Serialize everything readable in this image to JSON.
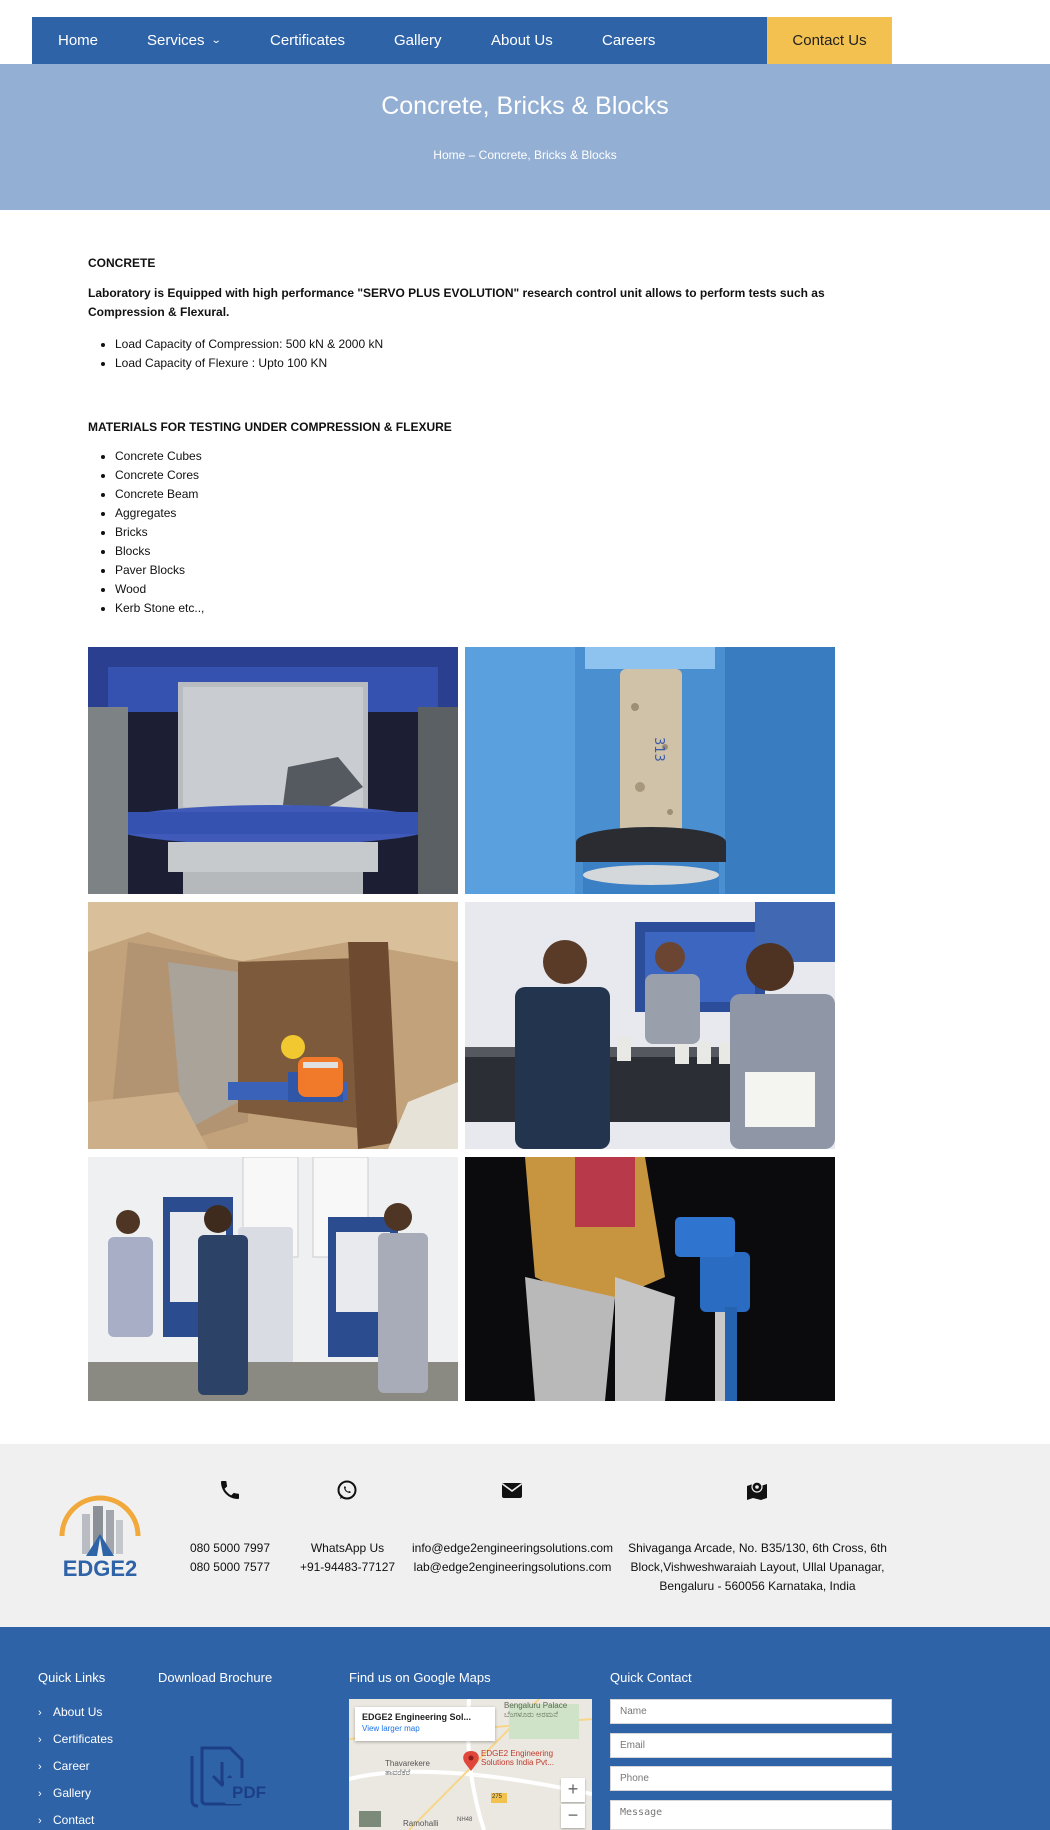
{
  "nav": {
    "items": [
      {
        "label": "Home"
      },
      {
        "label": "Services",
        "has_dropdown": true
      },
      {
        "label": "Certificates"
      },
      {
        "label": "Gallery"
      },
      {
        "label": "About Us"
      },
      {
        "label": "Careers"
      }
    ],
    "contact_label": "Contact Us",
    "dropdown_icon": "chevron-down-icon"
  },
  "hero": {
    "title": "Concrete, Bricks & Blocks",
    "breadcrumb": "Home – Concrete, Bricks & Blocks"
  },
  "content": {
    "section1_heading": "CONCRETE",
    "lead": "Laboratory is Equipped with high performance \"SERVO PLUS EVOLUTION\" research control unit allows to perform tests such as Compression & Flexural.",
    "capacities": [
      "Load Capacity of Compression: 500 kN & 2000 kN",
      "Load Capacity of Flexure : Upto 100 KN"
    ],
    "section2_heading": "MATERIALS FOR TESTING UNDER COMPRESSION & FLEXURE",
    "materials": [
      "Concrete Cubes",
      "Concrete Cores",
      "Concrete Beam",
      "Aggregates",
      "Bricks",
      "Blocks",
      "Paver Blocks",
      "Wood",
      "Kerb Stone etc..,"
    ]
  },
  "gallery": {
    "photos": [
      {
        "name": "concrete-cube-compression-photo"
      },
      {
        "name": "concrete-core-compression-photo"
      },
      {
        "name": "field-core-cutting-pit-photo"
      },
      {
        "name": "lab-technicians-samples-photo"
      },
      {
        "name": "lab-testing-machines-photo"
      },
      {
        "name": "night-core-drilling-photo"
      }
    ]
  },
  "contact_strip": {
    "logo_text": "EDGE2",
    "phone_icon": "phone-icon",
    "phone_lines": [
      "080 5000 7997",
      "080 5000 7577"
    ],
    "whatsapp_icon": "whatsapp-icon",
    "whatsapp_lines": [
      "WhatsApp Us",
      "+91-94483-77127"
    ],
    "email_icon": "envelope-icon",
    "email_lines": [
      "info@edge2engineeringsolutions.com",
      "lab@edge2engineeringsolutions.com"
    ],
    "address_icon": "map-marker-icon",
    "address_lines": [
      "Shivaganga Arcade, No. B35/130, 6th Cross, 6th",
      "Block,Vishweshwaraiah Layout, Ullal Upanagar,",
      "Bengaluru - 560056 Karnataka, India"
    ]
  },
  "footer": {
    "quick_links_heading": "Quick Links",
    "quick_links": [
      "About Us",
      "Certificates",
      "Career",
      "Gallery",
      "Contact"
    ],
    "brochure_heading": "Download Brochure",
    "brochure_icon": "pdf-download-icon",
    "brochure_icon_text": "PDF",
    "maps_heading": "Find us on Google Maps",
    "map": {
      "card_title": "EDGE2 Engineering Sol...",
      "card_link": "View larger map",
      "pin_label_1": "EDGE2 Engineering",
      "pin_label_2": "Solutions India Pvt...",
      "place_1": "Bengaluru Palace",
      "place_1b": "ಬೆಂಗಳೂರು ಅರಮನೆ",
      "place_2": "Thavarekere",
      "place_2b": "ತಾವರೆಕೆರೆ",
      "place_3": "Ramohalli",
      "road_1": "275",
      "road_2": "NH48",
      "zoom_in": "+",
      "zoom_out": "−"
    },
    "quick_contact_heading": "Quick Contact",
    "form": {
      "name_placeholder": "Name",
      "email_placeholder": "Email",
      "phone_placeholder": "Phone",
      "message_placeholder": "Message"
    }
  },
  "colors": {
    "nav_blue": "#2e63a8",
    "contact_yellow": "#f3c14f",
    "hero_blue": "#93afd3",
    "strip_gray": "#f0f0f0",
    "logo_orange": "#f2a93b"
  }
}
